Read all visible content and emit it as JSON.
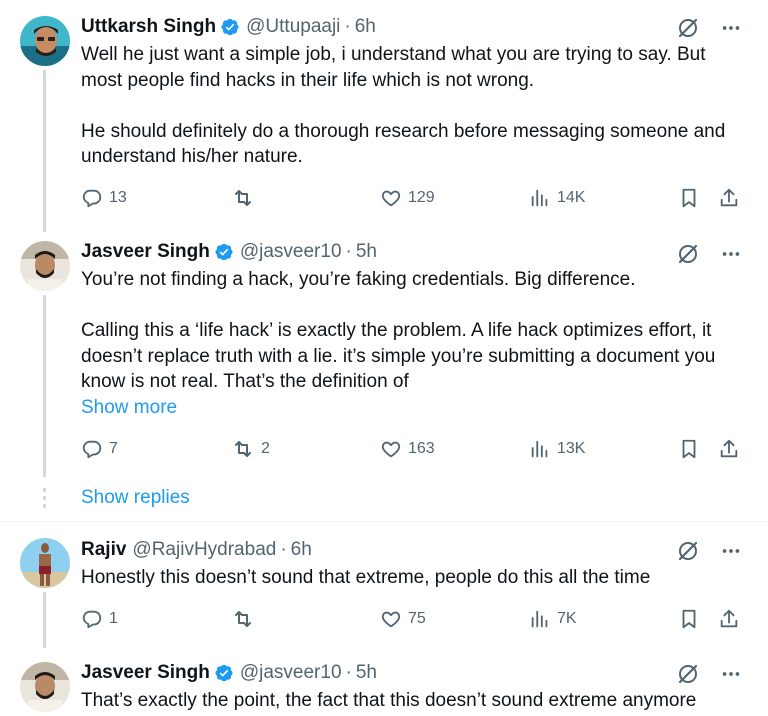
{
  "tweets": [
    {
      "name": "Uttkarsh Singh",
      "handle": "@Uttupaaji",
      "time": "6h",
      "verified": true,
      "body": [
        "Well he just want a simple job, i understand what you are trying to say. But most people find hacks in their life which is not wrong.",
        "He should definitely do a thorough research before messaging someone and understand his/her nature."
      ],
      "replies": "13",
      "retweets": "",
      "likes": "129",
      "views": "14K"
    },
    {
      "name": "Jasveer Singh",
      "handle": "@jasveer10",
      "time": "5h",
      "verified": true,
      "body": [
        "You’re not finding a hack, you’re faking credentials. Big difference.",
        "Calling this a ‘life hack’ is exactly the problem. A life hack optimizes effort, it doesn’t replace truth with a lie. it’s simple you’re submitting a document you know is not real. That’s the definition of"
      ],
      "show_more": "Show more",
      "replies": "7",
      "retweets": "2",
      "likes": "163",
      "views": "13K"
    },
    {
      "name": "Rajiv",
      "handle": "@RajivHydrabad",
      "time": "6h",
      "verified": false,
      "body": [
        "Honestly this doesn’t sound that extreme, people do this all the time"
      ],
      "replies": "1",
      "retweets": "",
      "likes": "75",
      "views": "7K"
    },
    {
      "name": "Jasveer Singh",
      "handle": "@jasveer10",
      "time": "5h",
      "verified": true,
      "body": [
        "That’s exactly the point, the fact that this doesn’t sound extreme anymore"
      ]
    }
  ],
  "show_replies": "Show replies",
  "separator": "·",
  "colors": {
    "accent": "#1d9bf0",
    "muted": "#536471",
    "thread_line": "#cfd9de"
  }
}
